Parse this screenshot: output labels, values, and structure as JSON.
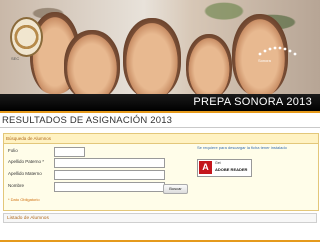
{
  "banner": {
    "title": "PREPA SONORA 2013",
    "seal_label": "SEC",
    "logo_caption": "Sonora"
  },
  "page": {
    "title": "RESULTADOS DE ASIGNACIÓN 2013"
  },
  "search": {
    "panel_title": "Búsqueda de Alumnos",
    "fields": {
      "folio": {
        "label": "Folio",
        "value": ""
      },
      "apellido_paterno": {
        "label": "Apellido Paterno *",
        "value": ""
      },
      "apellido_materno": {
        "label": "Apellido Materno",
        "value": ""
      },
      "nombre": {
        "label": "Nombre",
        "value": ""
      }
    },
    "required_note": "* Dato Obligatorio",
    "search_button": "Buscar",
    "help_text": "Se requiere para descargar la ficha tener instalado",
    "adobe": {
      "get": "Get",
      "name": "ADOBE READER"
    }
  },
  "listado": {
    "title": "Listado de Alumnos"
  },
  "colors": {
    "accent": "#e59a1c",
    "title_bar": "#000000",
    "panel_bg": "#fffde9"
  },
  "icons": [
    "school-seal-icon",
    "adobe-reader-icon"
  ]
}
